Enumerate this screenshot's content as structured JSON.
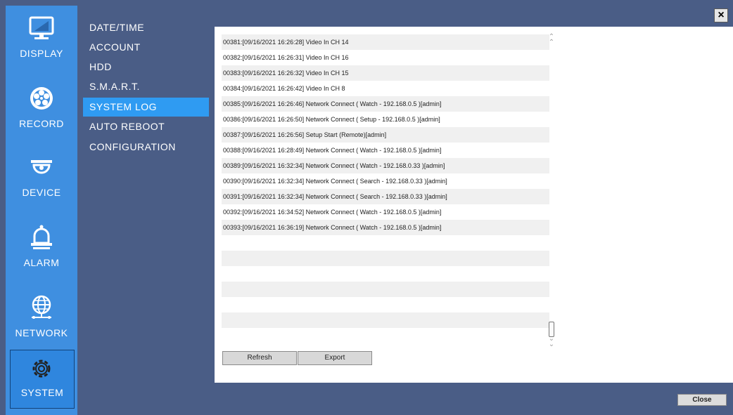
{
  "nav": {
    "items": [
      {
        "label": "DISPLAY",
        "icon": "monitor-icon"
      },
      {
        "label": "RECORD",
        "icon": "film-reel-icon"
      },
      {
        "label": "DEVICE",
        "icon": "camera-dome-icon"
      },
      {
        "label": "ALARM",
        "icon": "bell-icon"
      },
      {
        "label": "NETWORK",
        "icon": "globe-icon"
      },
      {
        "label": "SYSTEM",
        "icon": "gear-icon"
      }
    ],
    "active": "SYSTEM"
  },
  "submenu": {
    "items": [
      "DATE/TIME",
      "ACCOUNT",
      "HDD",
      "S.M.A.R.T.",
      "SYSTEM LOG",
      "AUTO REBOOT",
      "CONFIGURATION"
    ],
    "active": "SYSTEM LOG"
  },
  "log": {
    "entries": [
      "00381:[09/16/2021 16:26:28] Video In CH 14",
      "00382:[09/16/2021 16:26:31] Video In CH 16",
      "00383:[09/16/2021 16:26:32] Video In CH 15",
      "00384:[09/16/2021 16:26:42] Video In CH 8",
      "00385:[09/16/2021 16:26:46] Network Connect  ( Watch - 192.168.0.5 )[admin]",
      "00386:[09/16/2021 16:26:50] Network Connect  ( Setup - 192.168.0.5 )[admin]",
      "00387:[09/16/2021 16:26:56] Setup Start (Remote)[admin]",
      "00388:[09/16/2021 16:28:49] Network Connect  ( Watch - 192.168.0.5 )[admin]",
      "00389:[09/16/2021 16:32:34] Network Connect  ( Watch - 192.168.0.33 )[admin]",
      "00390:[09/16/2021 16:32:34] Network Connect  ( Search - 192.168.0.33 )[admin]",
      "00391:[09/16/2021 16:32:34] Network Connect  ( Search - 192.168.0.33 )[admin]",
      "00392:[09/16/2021 16:34:52] Network Connect  ( Watch - 192.168.0.5 )[admin]",
      "00393:[09/16/2021 16:36:19] Network Connect  ( Watch - 192.168.0.5 )[admin]",
      "",
      "",
      "",
      "",
      "",
      "",
      ""
    ]
  },
  "buttons": {
    "refresh": "Refresh",
    "export": "Export",
    "close": "Close",
    "close_x": "×"
  },
  "colors": {
    "frame": "#4a5d86",
    "nav_bg": "#3f8fe0",
    "active_sub": "#2f9bf2"
  }
}
